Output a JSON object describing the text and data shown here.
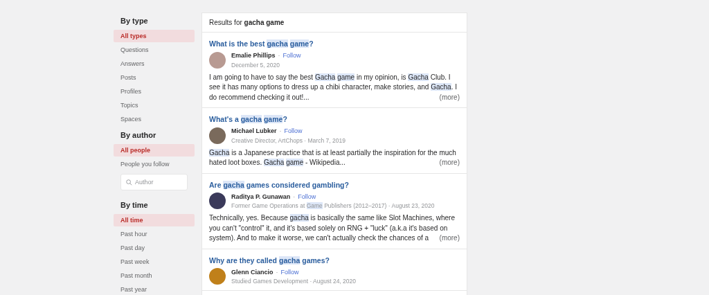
{
  "filters": [
    {
      "title": "By type",
      "items": [
        {
          "label": "All types",
          "selected": true
        },
        {
          "label": "Questions",
          "selected": false
        },
        {
          "label": "Answers",
          "selected": false
        },
        {
          "label": "Posts",
          "selected": false
        },
        {
          "label": "Profiles",
          "selected": false
        },
        {
          "label": "Topics",
          "selected": false
        },
        {
          "label": "Spaces",
          "selected": false
        }
      ]
    },
    {
      "title": "By author",
      "items": [
        {
          "label": "All people",
          "selected": true
        },
        {
          "label": "People you follow",
          "selected": false
        }
      ],
      "search": {
        "placeholder": "Author"
      }
    },
    {
      "title": "By time",
      "items": [
        {
          "label": "All time",
          "selected": true
        },
        {
          "label": "Past hour",
          "selected": false
        },
        {
          "label": "Past day",
          "selected": false
        },
        {
          "label": "Past week",
          "selected": false
        },
        {
          "label": "Past month",
          "selected": false
        },
        {
          "label": "Past year",
          "selected": false
        }
      ]
    }
  ],
  "results": {
    "prefix": "Results for",
    "query": "gacha game",
    "items": [
      {
        "title": [
          {
            "text": "What is the best ",
            "highlight": false
          },
          {
            "text": "gacha game",
            "highlight": true
          },
          {
            "text": "?",
            "highlight": false
          }
        ],
        "author": "Emalie Phillips",
        "separator": "·",
        "follow": "Follow",
        "meta": [
          {
            "text": "December 5, 2020",
            "highlight": false
          }
        ],
        "body": [
          {
            "text": "I am going to have to say the best ",
            "highlight": false
          },
          {
            "text": "Gacha game",
            "highlight": true
          },
          {
            "text": " in my opinion, is ",
            "highlight": false
          },
          {
            "text": "Gacha",
            "highlight": true
          },
          {
            "text": " Club. I see it has many options to dress up a chibi character, make stories, and ",
            "highlight": false
          },
          {
            "text": "Gacha",
            "highlight": true
          },
          {
            "text": ". I do recommend checking it out!...",
            "highlight": false
          }
        ],
        "more": "(more)"
      },
      {
        "title": [
          {
            "text": "What's a ",
            "highlight": false
          },
          {
            "text": "gacha game",
            "highlight": true
          },
          {
            "text": "?",
            "highlight": false
          }
        ],
        "author": "Michael Lubker",
        "separator": "·",
        "follow": "Follow",
        "meta": [
          {
            "text": "Creative Director, ArtChops · March 7, 2019",
            "highlight": false
          }
        ],
        "body": [
          {
            "text": "Gacha",
            "highlight": true
          },
          {
            "text": " is a Japanese practice that is at least partially the inspiration for the much hated loot boxes. ",
            "highlight": false
          },
          {
            "text": "Gacha game",
            "highlight": true
          },
          {
            "text": " - Wikipedia...",
            "highlight": false
          }
        ],
        "more": "(more)"
      },
      {
        "title": [
          {
            "text": "Are ",
            "highlight": false
          },
          {
            "text": "gacha",
            "highlight": true
          },
          {
            "text": " games considered gambling?",
            "highlight": false
          }
        ],
        "author": "Raditya P. Gunawan",
        "separator": "·",
        "follow": "Follow",
        "meta": [
          {
            "text": "Former Game Operations at ",
            "highlight": false
          },
          {
            "text": "Game",
            "highlight": true
          },
          {
            "text": " Publishers (2012–2017) · August 23, 2020",
            "highlight": false
          }
        ],
        "body": [
          {
            "text": "Technically, yes. Because ",
            "highlight": false
          },
          {
            "text": "gacha",
            "highlight": true
          },
          {
            "text": " is basically the same like Slot Machines, where you can't \"control\" it, and it's based solely on RNG + \"luck\" (a.k.a it's based on system). And to make it worse, we can't actually check the chances of a",
            "highlight": false
          }
        ],
        "more": "(more)"
      },
      {
        "title": [
          {
            "text": "Why are they called ",
            "highlight": false
          },
          {
            "text": "gacha",
            "highlight": true
          },
          {
            "text": " games?",
            "highlight": false
          }
        ],
        "author": "Glenn Ciancio",
        "separator": "·",
        "follow": "Follow",
        "meta": [
          {
            "text": "Studied Games Development · August 24, 2020",
            "highlight": false
          }
        ]
      }
    ]
  }
}
